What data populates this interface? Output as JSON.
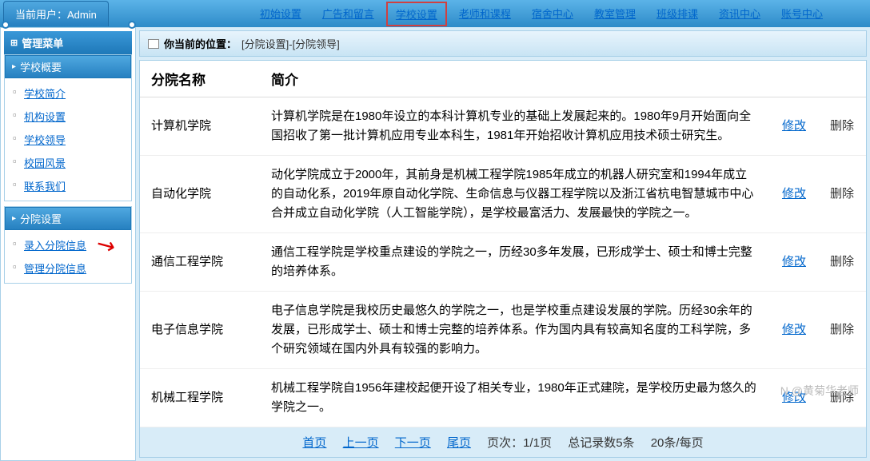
{
  "header": {
    "current_user_label": "当前用户：Admin"
  },
  "nav": [
    {
      "label": "初始设置",
      "active": false
    },
    {
      "label": "广告和留言",
      "active": false
    },
    {
      "label": "学校设置",
      "active": true
    },
    {
      "label": "老师和课程",
      "active": false
    },
    {
      "label": "宿舍中心",
      "active": false
    },
    {
      "label": "教室管理",
      "active": false
    },
    {
      "label": "班级排课",
      "active": false
    },
    {
      "label": "资讯中心",
      "active": false
    },
    {
      "label": "账号中心",
      "active": false
    }
  ],
  "sidebar": {
    "menu_title": "管理菜单",
    "panels": [
      {
        "title": "学校概要",
        "items": [
          "学校简介",
          "机构设置",
          "学校领导",
          "校园风景",
          "联系我们"
        ]
      },
      {
        "title": "分院设置",
        "items": [
          "录入分院信息",
          "管理分院信息"
        ]
      }
    ]
  },
  "breadcrumb": {
    "label": "你当前的位置：",
    "path": "[分院设置]-[分院领导]"
  },
  "table": {
    "headers": {
      "name": "分院名称",
      "desc": "简介"
    },
    "rows": [
      {
        "name": "计算机学院",
        "desc": "计算机学院是在1980年设立的本科计算机专业的基础上发展起来的。1980年9月开始面向全国招收了第一批计算机应用专业本科生，1981年开始招收计算机应用技术硕士研究生。"
      },
      {
        "name": "自动化学院",
        "desc": "动化学院成立于2000年，其前身是机械工程学院1985年成立的机器人研究室和1994年成立的自动化系，2019年原自动化学院、生命信息与仪器工程学院以及浙江省杭电智慧城市中心合并成立自动化学院（人工智能学院），是学校最富活力、发展最快的学院之一。"
      },
      {
        "name": "通信工程学院",
        "desc": "通信工程学院是学校重点建设的学院之一，历经30多年发展，已形成学士、硕士和博士完整的培养体系。"
      },
      {
        "name": "电子信息学院",
        "desc": "电子信息学院是我校历史最悠久的学院之一，也是学校重点建设发展的学院。历经30余年的发展，已形成学士、硕士和博士完整的培养体系。作为国内具有较高知名度的工科学院，多个研究领域在国内外具有较强的影响力。"
      },
      {
        "name": "机械工程学院",
        "desc": "机械工程学院自1956年建校起便开设了相关专业，1980年正式建院，是学校历史最为悠久的学院之一。"
      }
    ],
    "actions": {
      "edit": "修改",
      "delete": "删除"
    }
  },
  "pager": {
    "first": "首页",
    "prev": "上一页",
    "next": "下一页",
    "last": "尾页",
    "page_info": "页次：1/1页",
    "total": "总记录数5条",
    "per_page": "20条/每页"
  },
  "watermark": "N @黄菊华老师"
}
